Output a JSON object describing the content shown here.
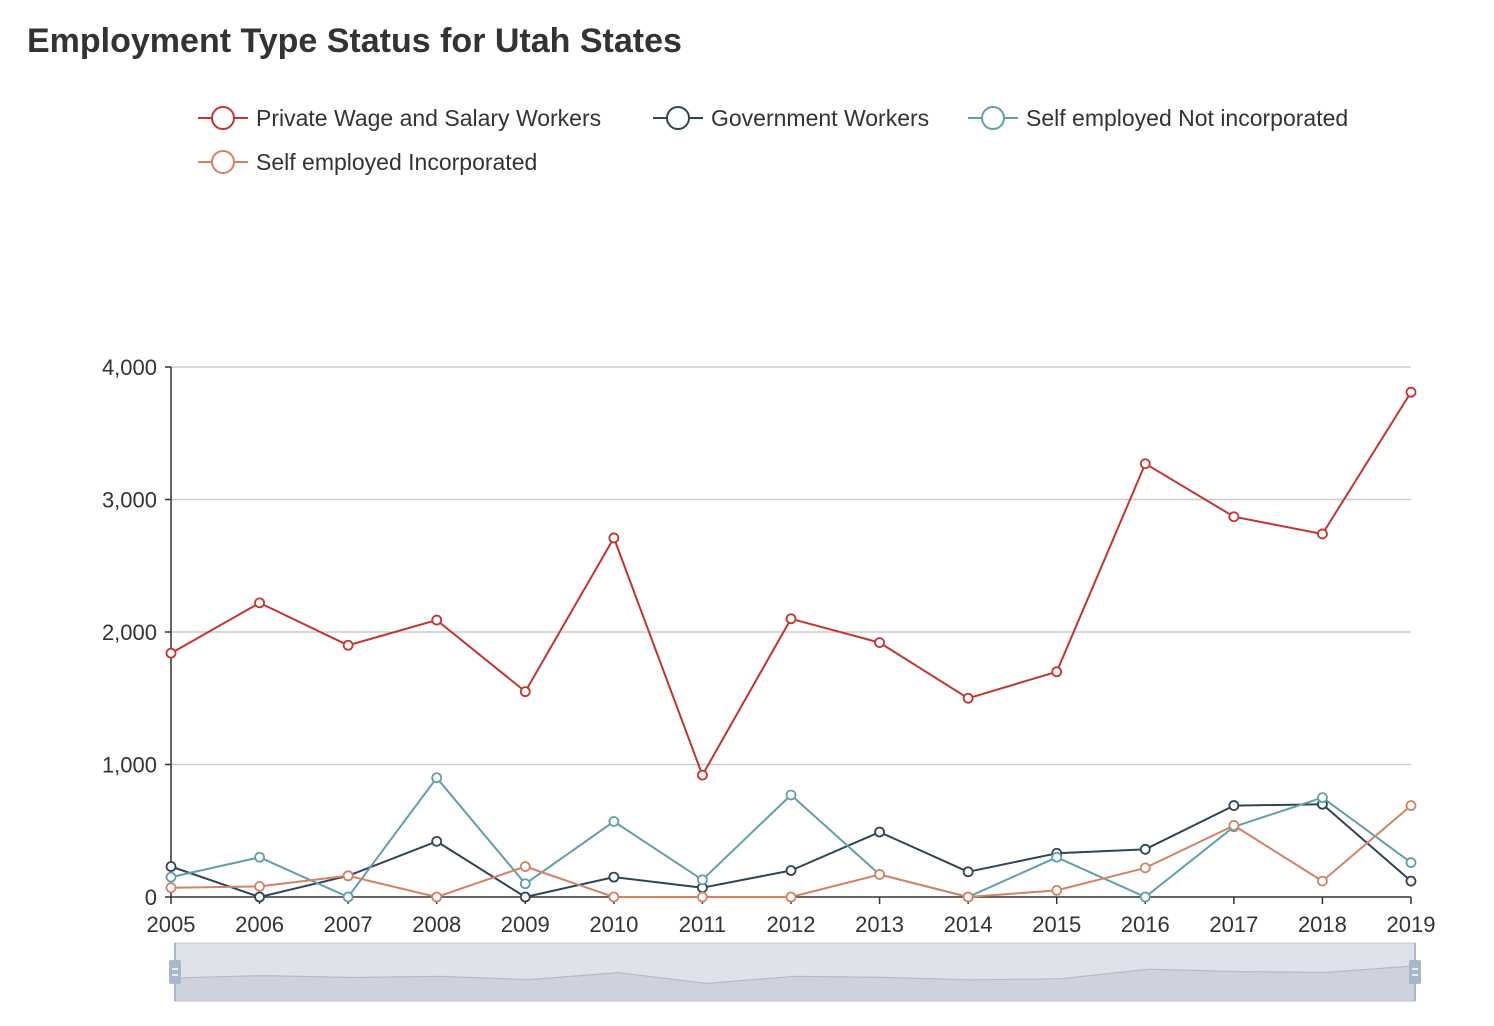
{
  "chart_data": {
    "type": "line",
    "title": "Employment Type Status for Utah States",
    "x": [
      "2005",
      "2006",
      "2007",
      "2008",
      "2009",
      "2010",
      "2011",
      "2012",
      "2013",
      "2014",
      "2015",
      "2016",
      "2017",
      "2018",
      "2019"
    ],
    "ylim": [
      0,
      4000
    ],
    "yticks": [
      0,
      1000,
      2000,
      3000,
      4000
    ],
    "ytick_labels": [
      "0",
      "1,000",
      "2,000",
      "3,000",
      "4,000"
    ],
    "grid": true,
    "legend_position": "top",
    "series": [
      {
        "name": "Private Wage and Salary Workers",
        "color": "#c23531",
        "values": [
          1840,
          2220,
          1900,
          2090,
          1550,
          2710,
          920,
          2100,
          1920,
          1500,
          1700,
          3270,
          2870,
          2740,
          3810
        ]
      },
      {
        "name": "Government Workers",
        "color": "#2f4554",
        "values": [
          230,
          0,
          160,
          420,
          0,
          150,
          70,
          200,
          490,
          190,
          330,
          360,
          690,
          700,
          120
        ]
      },
      {
        "name": "Self employed Not incorporated",
        "color": "#61a0a8",
        "values": [
          150,
          300,
          0,
          900,
          100,
          570,
          130,
          770,
          170,
          0,
          300,
          0,
          530,
          750,
          260
        ]
      },
      {
        "name": "Self employed Incorporated",
        "color": "#d48265",
        "values": [
          70,
          80,
          160,
          0,
          230,
          0,
          0,
          0,
          170,
          0,
          50,
          220,
          540,
          120,
          690
        ]
      }
    ],
    "datazoom": {
      "start": "2005",
      "end": "2019"
    }
  }
}
